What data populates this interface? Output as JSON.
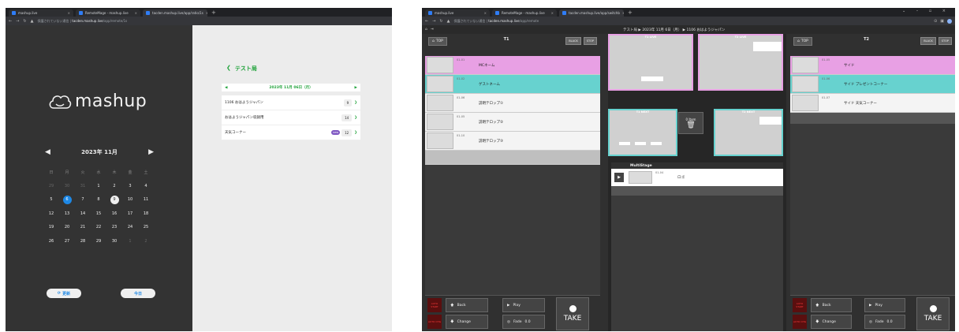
{
  "browser1": {
    "tabs": [
      {
        "label": "mashup.live"
      },
      {
        "label": "RemoteMage - mashup.live"
      },
      {
        "label": "tacden.mashup.live/app/ratio/1s"
      }
    ],
    "url_prefix": "保護されていない通信 |",
    "url_host": "tacden.mashup.live",
    "url_path": "/app/remote/1s"
  },
  "browser2": {
    "tabs": [
      {
        "label": "mashup.live"
      },
      {
        "label": "RemoteMage - mashup.live"
      },
      {
        "label": "tacden.mashup.live/app/switchb"
      }
    ],
    "url_prefix": "保護されていない通信 |",
    "url_host": "tacden.mashup.live",
    "url_path": "/app/remote"
  },
  "calendar": {
    "logo": "mashup",
    "month": "2023年 11月",
    "weekdays": [
      "日",
      "月",
      "火",
      "水",
      "木",
      "金",
      "土"
    ],
    "weeks": [
      [
        {
          "d": "29",
          "t": "other"
        },
        {
          "d": "30",
          "t": "other"
        },
        {
          "d": "31",
          "t": "other"
        },
        {
          "d": "1"
        },
        {
          "d": "2"
        },
        {
          "d": "3"
        },
        {
          "d": "4"
        }
      ],
      [
        {
          "d": "5"
        },
        {
          "d": "6",
          "t": "selected"
        },
        {
          "d": "7"
        },
        {
          "d": "8"
        },
        {
          "d": "9",
          "t": "today"
        },
        {
          "d": "10"
        },
        {
          "d": "11"
        }
      ],
      [
        {
          "d": "12"
        },
        {
          "d": "13"
        },
        {
          "d": "14"
        },
        {
          "d": "15"
        },
        {
          "d": "16"
        },
        {
          "d": "17"
        },
        {
          "d": "18"
        }
      ],
      [
        {
          "d": "19"
        },
        {
          "d": "20"
        },
        {
          "d": "21"
        },
        {
          "d": "22"
        },
        {
          "d": "23"
        },
        {
          "d": "24"
        },
        {
          "d": "25"
        }
      ],
      [
        {
          "d": "26"
        },
        {
          "d": "27"
        },
        {
          "d": "28"
        },
        {
          "d": "29"
        },
        {
          "d": "30"
        },
        {
          "d": "1",
          "t": "other"
        },
        {
          "d": "2",
          "t": "other"
        }
      ]
    ],
    "update_label": "更新",
    "today_label": "今日"
  },
  "program": {
    "title": "テスト局",
    "date": "2023年 11月 06日（月）",
    "items": [
      {
        "name": "1106 おはようジャパン",
        "count": "9",
        "badge": ""
      },
      {
        "name": "おはようジャパン収録用",
        "count": "14",
        "badge": ""
      },
      {
        "name": "天気コーナー",
        "count": "12",
        "badge": "new"
      }
    ]
  },
  "switcher": {
    "breadcrumb": "テスト局  ▶  2023年 11月 6日（月）  ▶  1106 おはようジャパン",
    "top_label": "TOP",
    "black_label": "BLACK",
    "stop_label": "STOP",
    "t1": {
      "title": "T1",
      "rows": [
        {
          "num": "01-01",
          "name": "MCネーム",
          "color": "pink"
        },
        {
          "num": "01-02",
          "name": "ゲストネーム",
          "color": "teal"
        },
        {
          "num": "01-06",
          "name": "説明テロップ①",
          "color": "white"
        },
        {
          "num": "01-05",
          "name": "説明テロップ②",
          "color": "white"
        },
        {
          "num": "01-10",
          "name": "説明テロップ③",
          "color": "white"
        }
      ]
    },
    "t2": {
      "title": "T2",
      "rows": [
        {
          "num": "01-05",
          "name": "サイド",
          "color": "pink"
        },
        {
          "num": "01-06",
          "name": "サイド プレゼントコーナー",
          "color": "teal"
        },
        {
          "num": "01-07",
          "name": "サイド 天気コーナー",
          "color": "white"
        }
      ]
    },
    "t1_live": "T1 LIVE",
    "t2_live": "T2 LIVE",
    "t1_next": "T1 NEXT",
    "t2_next": "T2 NEXT",
    "item_label": "0 Item",
    "multistage_label": "MultiStage",
    "ms_row": {
      "num": "01-04",
      "name": "ロゴ"
    },
    "controls": {
      "auto_start": "AUTO START",
      "auto_chg": "AUTO CHG",
      "back": "Back",
      "change": "Change",
      "play": "Play",
      "fade": "Fade",
      "fade_val": "0.0",
      "take": "TAKE"
    },
    "colors": {
      "pink": "#e8a0e4",
      "teal": "#67d2cf",
      "green": "#21a33b",
      "blue": "#1e88e5"
    }
  }
}
